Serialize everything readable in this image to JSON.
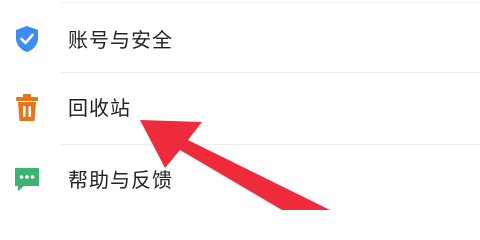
{
  "menu": {
    "items": [
      {
        "label": "账号与安全",
        "icon": "shield-check-icon",
        "color": "#3d8bf5"
      },
      {
        "label": "回收站",
        "icon": "trash-icon",
        "color": "#e8751a"
      },
      {
        "label": "帮助与反馈",
        "icon": "chat-bubble-icon",
        "color": "#3cb371"
      }
    ]
  },
  "annotation": {
    "icon": "red-arrow-icon",
    "color": "#ee2b3a"
  }
}
